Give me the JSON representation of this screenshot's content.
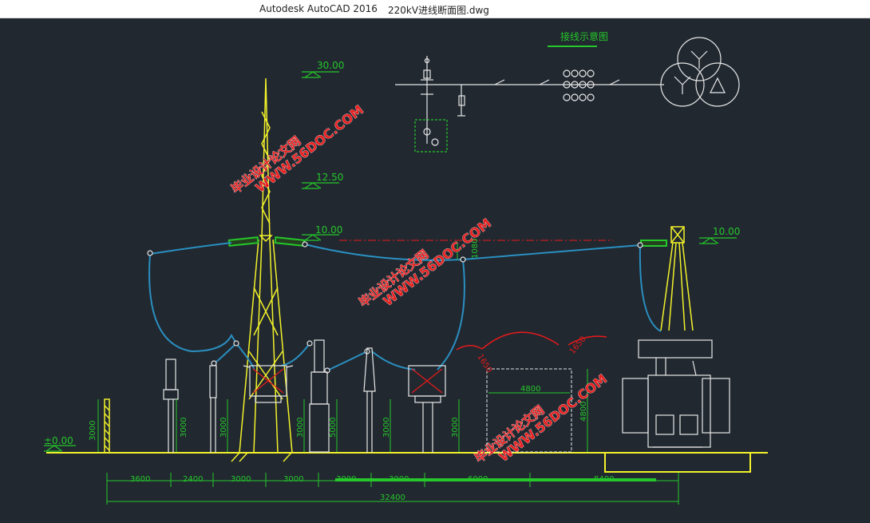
{
  "window": {
    "app_title": "Autodesk AutoCAD 2016",
    "document_title": "220kV进线断面图.dwg"
  },
  "drawing": {
    "diagram_title": "接线示意图",
    "level_labels": {
      "top": "30.00",
      "mid": "12.50",
      "beam_left": "10.00",
      "beam_right": "10.00",
      "ground": "±0.00"
    },
    "height_labels": [
      "3000",
      "3000",
      "3000",
      "3000",
      "3000",
      "5000",
      "3000",
      "3000",
      "4800"
    ],
    "sag_label": "1080",
    "clearance_labels": [
      "1650",
      "1650"
    ],
    "box_width_label": "4800",
    "spacing_labels": [
      "3600",
      "2400",
      "3000",
      "3000",
      "3000",
      "3000",
      "6000",
      "8400"
    ],
    "total_label": "32400",
    "watermark": {
      "url_text": "WWW.56DOC.COM",
      "cn_text": "毕业设计论文网"
    },
    "colors": {
      "background": "#212830",
      "dimension": "#25c72a",
      "structure": "#f2f22a",
      "conductor": "#2a8fc0",
      "equipment": "#e8e8e8",
      "clearance": "#e81a1a",
      "watermark": "#e82020"
    }
  }
}
